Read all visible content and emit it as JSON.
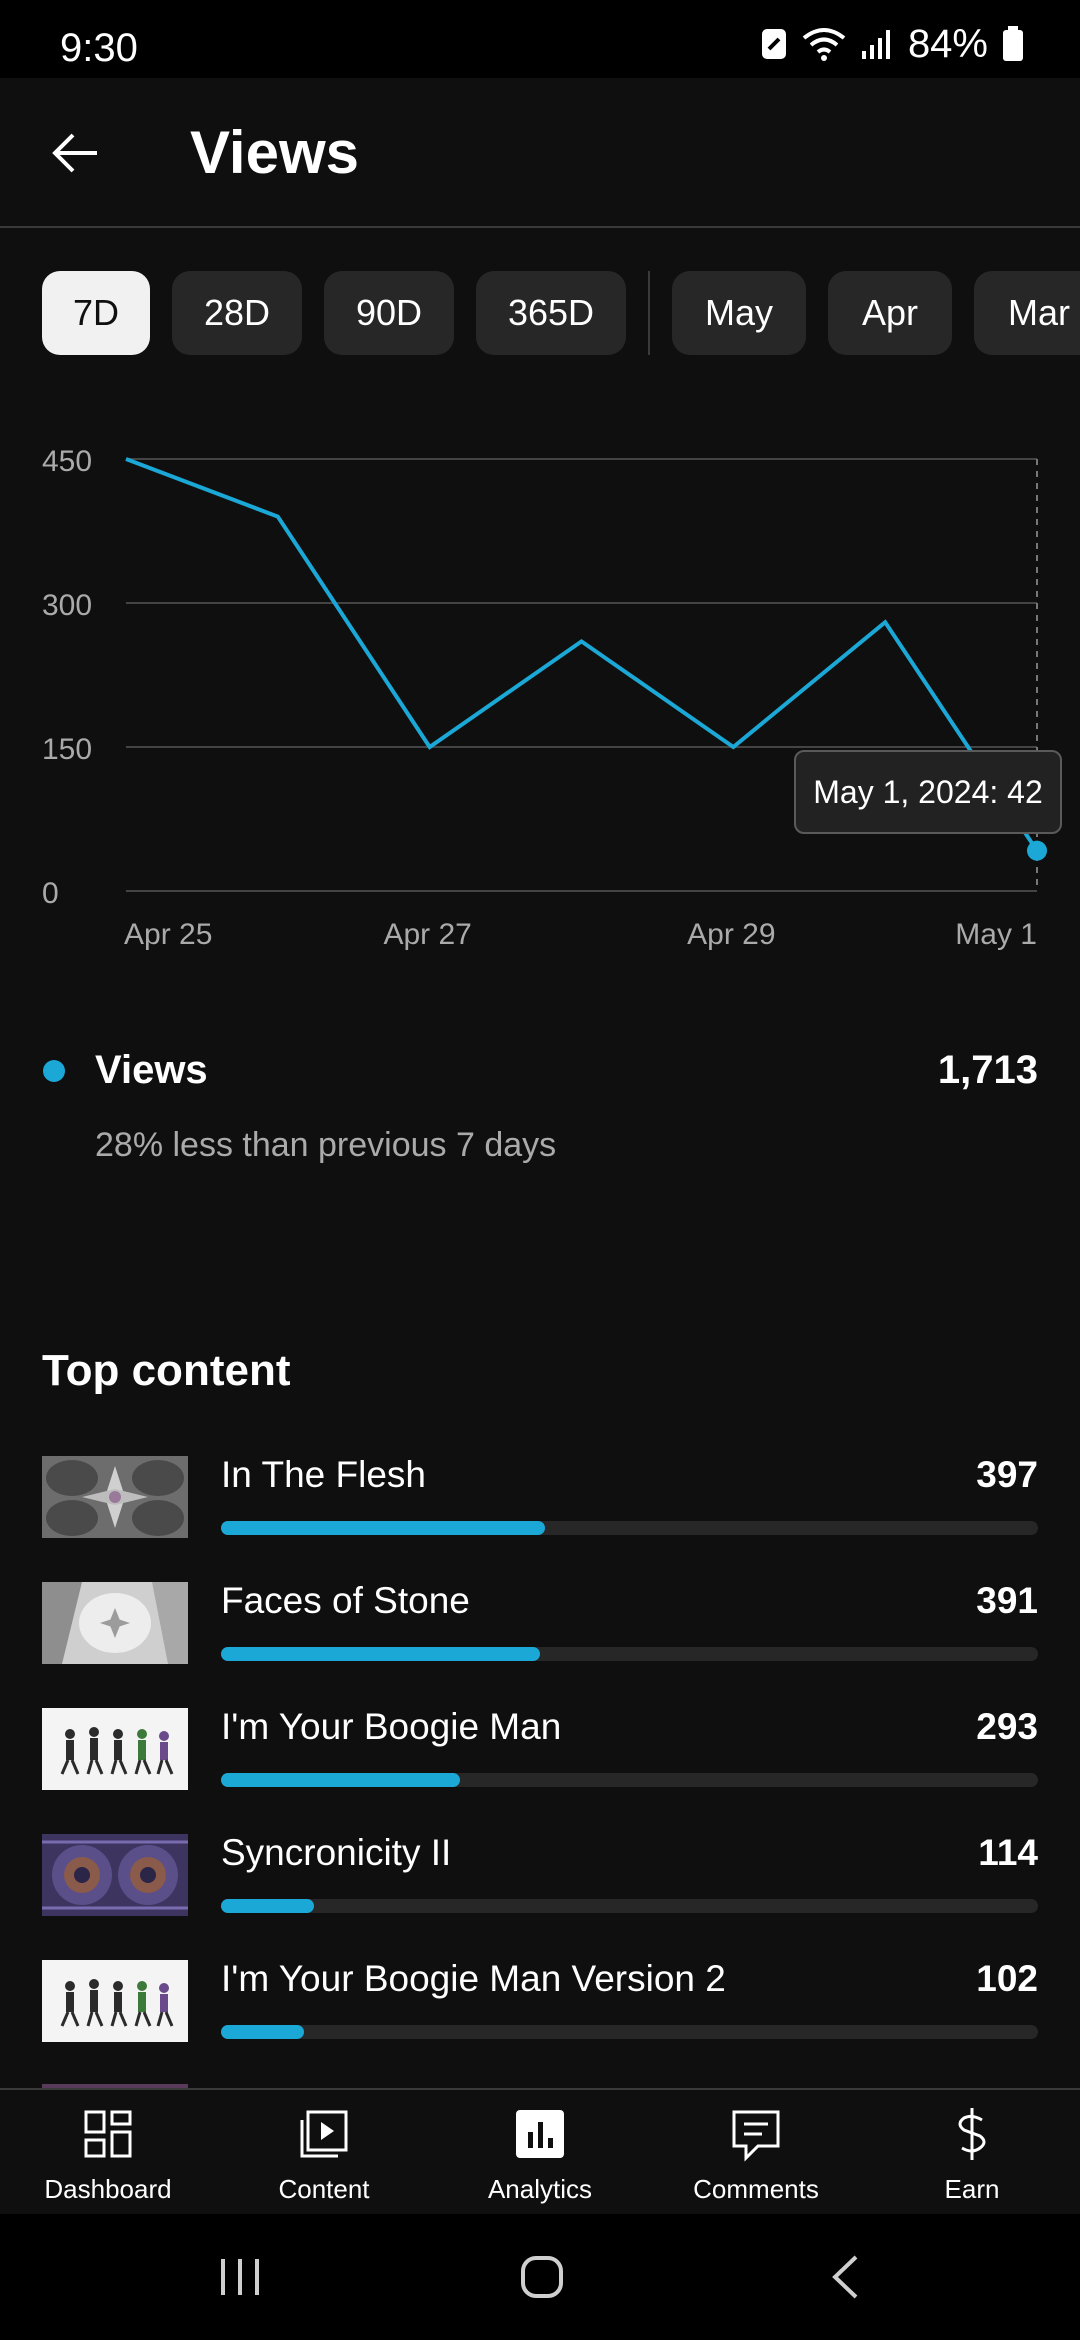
{
  "status_bar": {
    "time": "9:30",
    "battery": "84%"
  },
  "header": {
    "title": "Views"
  },
  "chips": {
    "ranges": [
      "7D",
      "28D",
      "90D",
      "365D"
    ],
    "months": [
      "May",
      "Apr",
      "Mar"
    ],
    "selected": "7D"
  },
  "chart_data": {
    "type": "line",
    "x": [
      "Apr 25",
      "Apr 26",
      "Apr 27",
      "Apr 28",
      "Apr 29",
      "Apr 30",
      "May 1"
    ],
    "x_tick_labels": [
      "Apr 25",
      "Apr 27",
      "Apr 29",
      "May 1"
    ],
    "series": [
      {
        "name": "Views",
        "values": [
          450,
          390,
          150,
          260,
          150,
          280,
          42
        ]
      }
    ],
    "yticks": [
      0,
      150,
      300,
      450
    ],
    "ylim": [
      0,
      450
    ],
    "grid": true,
    "tooltip": "May 1, 2024: 42",
    "color": "#1ba8d6"
  },
  "summary": {
    "label": "Views",
    "total": "1,713",
    "comparison": "28% less than previous 7 days",
    "color": "#1ba8d6"
  },
  "top_content": {
    "title": "Top content",
    "max": 1000,
    "items": [
      {
        "title": "In The Flesh",
        "value": "397",
        "views": 397,
        "thumb": "fractal-gray"
      },
      {
        "title": "Faces of Stone",
        "value": "391",
        "views": 391,
        "thumb": "stone-white"
      },
      {
        "title": "I'm Your Boogie Man",
        "value": "293",
        "views": 293,
        "thumb": "dancers-white"
      },
      {
        "title": "Syncronicity II",
        "value": "114",
        "views": 114,
        "thumb": "spiral-purple"
      },
      {
        "title": "I'm Your Boogie Man Version 2",
        "value": "102",
        "views": 102,
        "thumb": "dancers-white"
      }
    ]
  },
  "bottom_nav": [
    {
      "label": "Dashboard",
      "icon": "dashboard-icon",
      "active": false
    },
    {
      "label": "Content",
      "icon": "content-icon",
      "active": false
    },
    {
      "label": "Analytics",
      "icon": "analytics-icon",
      "active": true
    },
    {
      "label": "Comments",
      "icon": "comments-icon",
      "active": false
    },
    {
      "label": "Earn",
      "icon": "earn-icon",
      "active": false
    }
  ],
  "colors": {
    "accent": "#1ba8d6",
    "background": "#0f0f0f",
    "chip": "#272727"
  }
}
